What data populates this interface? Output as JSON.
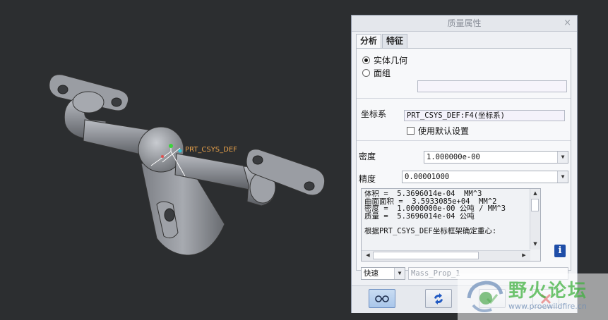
{
  "viewport": {
    "csys_label": "PRT_CSYS_DEF",
    "background_color": "#2c2e30"
  },
  "dialog": {
    "title": "质量属性",
    "close_glyph": "×",
    "tabs": [
      {
        "label": "分析",
        "active": true
      },
      {
        "label": "特征",
        "active": false
      }
    ],
    "geometry_options": [
      {
        "label": "实体几何",
        "selected": true
      },
      {
        "label": "面组",
        "selected": false
      }
    ],
    "quilt_field_value": "",
    "csys_label": "坐标系",
    "csys_value": "PRT_CSYS_DEF:F4(坐标系)",
    "use_default_label": "使用默认设置",
    "use_default_checked": false,
    "density_label": "密度",
    "density_value": "1.000000e-00",
    "accuracy_label": "精度",
    "accuracy_value": "0.00001000",
    "results_lines": [
      "体积 =  5.3696014e-04  MM^3",
      "曲面面积 =  3.5933085e+04  MM^2",
      "密度 =  1.0000000e-00 公吨 / MM^3",
      "质量 =  5.3696014e-04 公吨",
      "",
      "根据PRT_CSYS_DEF坐标框架确定重心:"
    ],
    "info_icon": "info-icon",
    "mode_value": "快速",
    "feature_name_placeholder": "Mass_Prop_1",
    "buttons": [
      "preview-icon",
      "recompute-icon",
      "ok-icon",
      "cancel-icon"
    ]
  },
  "watermark": {
    "text": "野火论坛",
    "url": "www.proewildfire.cn"
  }
}
